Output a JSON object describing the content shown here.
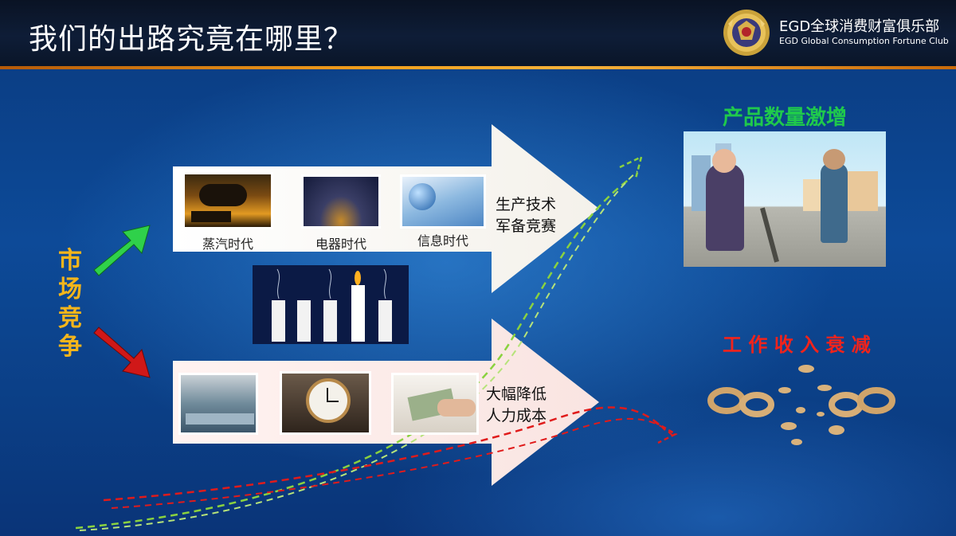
{
  "header": {
    "title": "我们的出路究竟在哪里？",
    "brand_cn": "EGD全球消费财富俱乐部",
    "brand_en": "EGD Global Consumption Fortune Club"
  },
  "left_label": [
    "市",
    "场",
    "竞",
    "争"
  ],
  "top_arrow": {
    "items": [
      {
        "label": "蒸汽时代",
        "image": "steam-train-image"
      },
      {
        "label": "电器时代",
        "image": "city-lights-image"
      },
      {
        "label": "信息时代",
        "image": "globe-data-image"
      }
    ],
    "text_line1": "生产技术",
    "text_line2": "军备竞赛"
  },
  "bottom_arrow": {
    "items": [
      {
        "image": "factory-workers-image"
      },
      {
        "image": "clock-image"
      },
      {
        "image": "money-handshake-image"
      }
    ],
    "text_line1": "大幅降低",
    "text_line2": "人力成本"
  },
  "right_top": {
    "title": "产品数量激增",
    "image": "rich-poor-cartoon-image",
    "color": "#1fc94c"
  },
  "right_bottom": {
    "title": "工 作 收 入 衰 减",
    "image": "broken-chain-image",
    "color": "#f2231b"
  },
  "colors": {
    "accent_orange": "#f4a11e",
    "green_arrow": "#2fd14a",
    "red_arrow": "#d01818",
    "gold_text": "#f4b51b"
  }
}
